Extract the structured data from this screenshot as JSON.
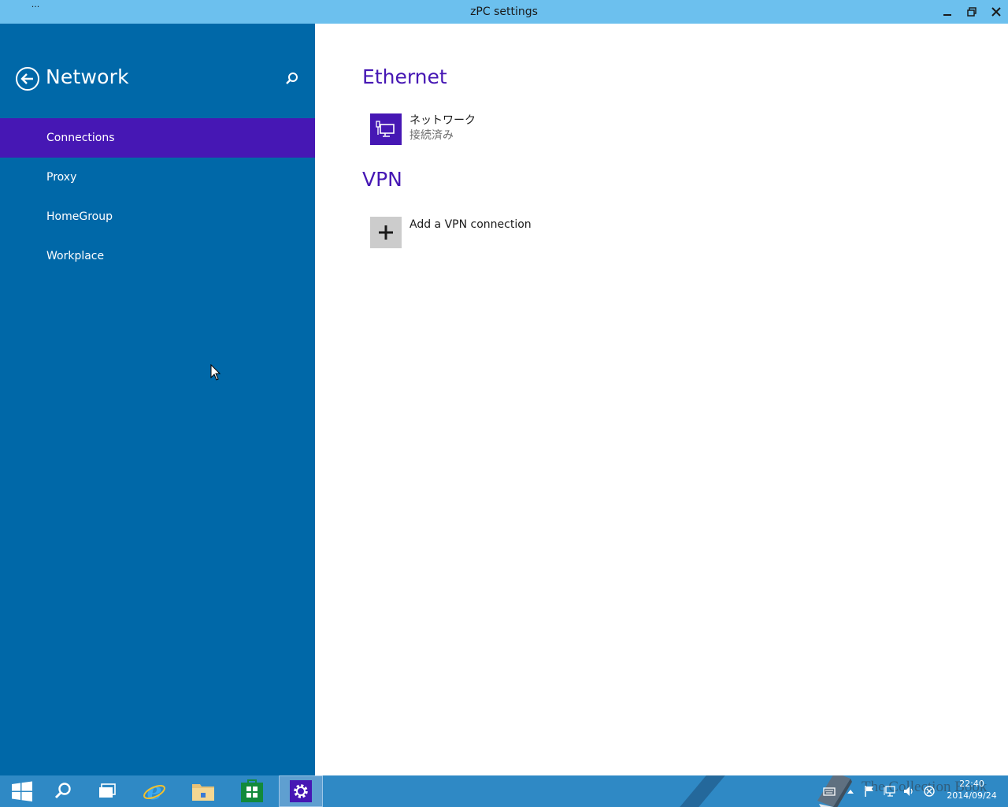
{
  "window": {
    "title": "zPC settings",
    "menu_label": "···"
  },
  "left_pane": {
    "title": "Network",
    "nav_items": [
      {
        "label": "Connections",
        "selected": true
      },
      {
        "label": "Proxy",
        "selected": false
      },
      {
        "label": "HomeGroup",
        "selected": false
      },
      {
        "label": "Workplace",
        "selected": false
      }
    ]
  },
  "content": {
    "ethernet": {
      "heading": "Ethernet",
      "connection_name": "ネットワーク",
      "connection_status": "接続済み",
      "icon": "ethernet-monitor-icon"
    },
    "vpn": {
      "heading": "VPN",
      "add_label": "Add a VPN connection",
      "icon": "plus-icon"
    }
  },
  "taskbar": {
    "apps": [
      "start-icon",
      "search-icon",
      "task-view-icon",
      "internet-explorer-icon",
      "file-explorer-icon",
      "store-icon",
      "settings-gear-icon"
    ],
    "active_app": "settings-gear-icon",
    "watermark": "The Collection Book",
    "clock": {
      "time": "22:40",
      "date": "2014/09/24"
    }
  },
  "colors": {
    "titlebar": "#6cc0ee",
    "left_pane": "#0068a8",
    "accent": "#4617b4",
    "taskbar": "#2f89c5"
  }
}
